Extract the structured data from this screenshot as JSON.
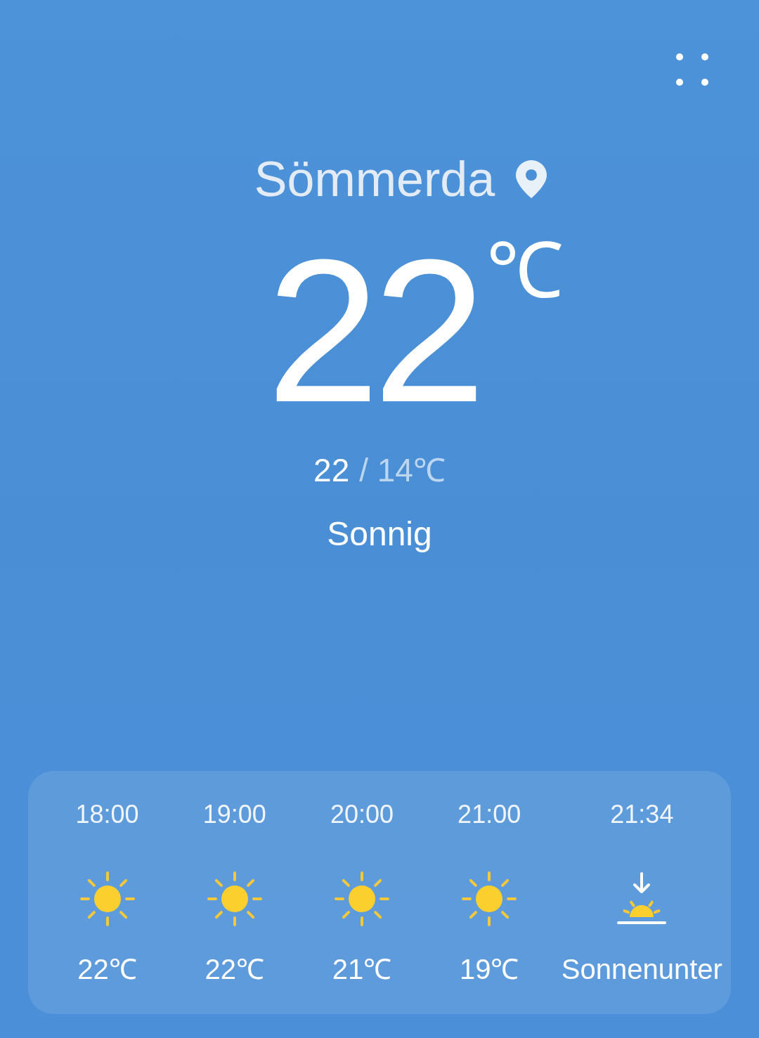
{
  "location": {
    "city": "Sömmerda"
  },
  "current": {
    "temperature": "22",
    "unit": "℃",
    "high": "22",
    "low": "/ 14℃",
    "condition": "Sonnig"
  },
  "hourly": [
    {
      "time": "18:00",
      "kind": "sun",
      "value": "22℃"
    },
    {
      "time": "19:00",
      "kind": "sun",
      "value": "22℃"
    },
    {
      "time": "20:00",
      "kind": "sun",
      "value": "21℃"
    },
    {
      "time": "21:00",
      "kind": "sun",
      "value": "19℃"
    },
    {
      "time": "21:34",
      "kind": "sunset",
      "value": "Sonnenunter"
    }
  ]
}
